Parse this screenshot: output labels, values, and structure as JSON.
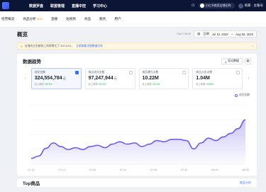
{
  "topbar": {
    "nav": [
      "数据罗盘",
      "联盟管理",
      "直播中控",
      "学习中心"
    ],
    "shop_label": "小红书商家店铺名称",
    "user_label": "商家 · 主账号"
  },
  "subnav": {
    "items": [
      "经营概览",
      "商品分析",
      "直播",
      "短视频",
      "商品",
      "服务",
      "用户"
    ],
    "new_badge": "NEW"
  },
  "header": {
    "title": "概览",
    "time_label": "GMT+08:00",
    "date_label": "日期",
    "date_start": "Jul 10, 2023",
    "date_sep": "~",
    "date_end": "Aug 06, 2023"
  },
  "alert": {
    "text": "店铺成交金额较上周期增长了 326.63%，",
    "link": "立即查看详细数据分析"
  },
  "trend": {
    "title": "数据趋势",
    "export_label": "导出数据",
    "legend": "成交金额",
    "metrics": [
      {
        "label": "成交金额",
        "value": "324,554,784",
        "unit": "元",
        "delta_label": "较上周期",
        "delta": "+30.1%",
        "active": true
      },
      {
        "label": "商品成交金额",
        "value": "97,247,944",
        "unit": "元",
        "delta_label": "较上周期",
        "delta": "+43.2%",
        "active": false
      },
      {
        "label": "商品曝光次数",
        "value": "10.22M",
        "unit": "",
        "delta_label": "较上周期",
        "delta": "+20.1%",
        "active": false
      },
      {
        "label": "商品点击次数",
        "value": "1.04M",
        "unit": "",
        "delta_label": "较上周期",
        "delta": "+23.8%",
        "active": false
      }
    ]
  },
  "chart_data": {
    "type": "area",
    "x": [
      "07-10",
      "07-14",
      "07-18",
      "07-22",
      "07-26",
      "07-30",
      "08-03",
      "08-06"
    ],
    "series": [
      {
        "name": "成交金额",
        "values": [
          10,
          14,
          27,
          36,
          30,
          25,
          28,
          25,
          30,
          32,
          28,
          34,
          38,
          34,
          36,
          30,
          34,
          40,
          38,
          42,
          42,
          40,
          26,
          36,
          44,
          40,
          46,
          52,
          60,
          75
        ]
      }
    ],
    "ylim": [
      0,
      100
    ],
    "grid": true,
    "color": "#6d5ce8"
  },
  "bottom": {
    "title": "Top商品",
    "link": "商品分析"
  },
  "colors": {
    "accent": "#3370ff",
    "chart": "#6d5ce8",
    "topbar": "#0b1535"
  }
}
